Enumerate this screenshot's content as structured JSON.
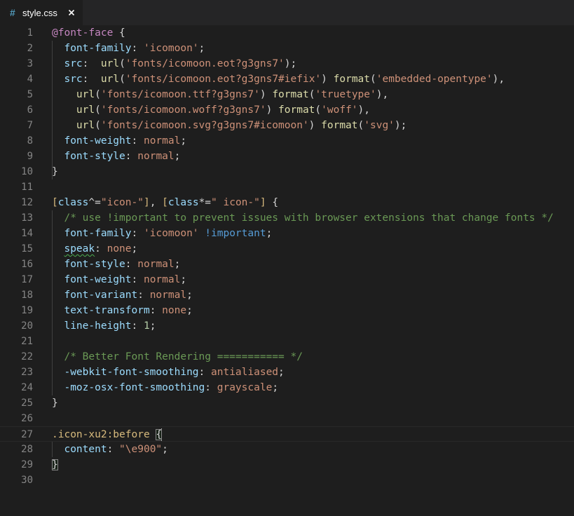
{
  "tab": {
    "icon_glyph": "#",
    "label": "style.css",
    "close_glyph": "×"
  },
  "lines": [
    {
      "num": "1",
      "tokens": [
        {
          "t": "@font-face",
          "c": "t-at"
        },
        {
          "t": " {",
          "c": "t-punc"
        }
      ]
    },
    {
      "num": "2",
      "tokens": [
        {
          "t": "  ",
          "c": "t-punc"
        },
        {
          "t": "font-family",
          "c": "t-prop"
        },
        {
          "t": ": ",
          "c": "t-punc"
        },
        {
          "t": "'icomoon'",
          "c": "t-str"
        },
        {
          "t": ";",
          "c": "t-punc"
        }
      ]
    },
    {
      "num": "3",
      "tokens": [
        {
          "t": "  ",
          "c": "t-punc"
        },
        {
          "t": "src",
          "c": "t-prop"
        },
        {
          "t": ":  ",
          "c": "t-punc"
        },
        {
          "t": "url",
          "c": "t-fn"
        },
        {
          "t": "(",
          "c": "t-punc"
        },
        {
          "t": "'fonts/icomoon.eot?g3gns7'",
          "c": "t-str"
        },
        {
          "t": ");",
          "c": "t-punc"
        }
      ]
    },
    {
      "num": "4",
      "tokens": [
        {
          "t": "  ",
          "c": "t-punc"
        },
        {
          "t": "src",
          "c": "t-prop"
        },
        {
          "t": ":  ",
          "c": "t-punc"
        },
        {
          "t": "url",
          "c": "t-fn"
        },
        {
          "t": "(",
          "c": "t-punc"
        },
        {
          "t": "'fonts/icomoon.eot?g3gns7#iefix'",
          "c": "t-str"
        },
        {
          "t": ") ",
          "c": "t-punc"
        },
        {
          "t": "format",
          "c": "t-fn"
        },
        {
          "t": "(",
          "c": "t-punc"
        },
        {
          "t": "'embedded-opentype'",
          "c": "t-str"
        },
        {
          "t": "),",
          "c": "t-punc"
        }
      ]
    },
    {
      "num": "5",
      "tokens": [
        {
          "t": "    ",
          "c": "t-punc"
        },
        {
          "t": "url",
          "c": "t-fn"
        },
        {
          "t": "(",
          "c": "t-punc"
        },
        {
          "t": "'fonts/icomoon.ttf?g3gns7'",
          "c": "t-str"
        },
        {
          "t": ") ",
          "c": "t-punc"
        },
        {
          "t": "format",
          "c": "t-fn"
        },
        {
          "t": "(",
          "c": "t-punc"
        },
        {
          "t": "'truetype'",
          "c": "t-str"
        },
        {
          "t": "),",
          "c": "t-punc"
        }
      ]
    },
    {
      "num": "6",
      "tokens": [
        {
          "t": "    ",
          "c": "t-punc"
        },
        {
          "t": "url",
          "c": "t-fn"
        },
        {
          "t": "(",
          "c": "t-punc"
        },
        {
          "t": "'fonts/icomoon.woff?g3gns7'",
          "c": "t-str"
        },
        {
          "t": ") ",
          "c": "t-punc"
        },
        {
          "t": "format",
          "c": "t-fn"
        },
        {
          "t": "(",
          "c": "t-punc"
        },
        {
          "t": "'woff'",
          "c": "t-str"
        },
        {
          "t": "),",
          "c": "t-punc"
        }
      ]
    },
    {
      "num": "7",
      "tokens": [
        {
          "t": "    ",
          "c": "t-punc"
        },
        {
          "t": "url",
          "c": "t-fn"
        },
        {
          "t": "(",
          "c": "t-punc"
        },
        {
          "t": "'fonts/icomoon.svg?g3gns7#icomoon'",
          "c": "t-str"
        },
        {
          "t": ") ",
          "c": "t-punc"
        },
        {
          "t": "format",
          "c": "t-fn"
        },
        {
          "t": "(",
          "c": "t-punc"
        },
        {
          "t": "'svg'",
          "c": "t-str"
        },
        {
          "t": ");",
          "c": "t-punc"
        }
      ]
    },
    {
      "num": "8",
      "tokens": [
        {
          "t": "  ",
          "c": "t-punc"
        },
        {
          "t": "font-weight",
          "c": "t-prop"
        },
        {
          "t": ": ",
          "c": "t-punc"
        },
        {
          "t": "normal",
          "c": "t-str"
        },
        {
          "t": ";",
          "c": "t-punc"
        }
      ]
    },
    {
      "num": "9",
      "tokens": [
        {
          "t": "  ",
          "c": "t-punc"
        },
        {
          "t": "font-style",
          "c": "t-prop"
        },
        {
          "t": ": ",
          "c": "t-punc"
        },
        {
          "t": "normal",
          "c": "t-str"
        },
        {
          "t": ";",
          "c": "t-punc"
        }
      ]
    },
    {
      "num": "10",
      "tokens": [
        {
          "t": "}",
          "c": "t-punc"
        }
      ]
    },
    {
      "num": "11",
      "tokens": []
    },
    {
      "num": "12",
      "tokens": [
        {
          "t": "[",
          "c": "t-sel"
        },
        {
          "t": "class",
          "c": "t-attr"
        },
        {
          "t": "^=",
          "c": "t-punc"
        },
        {
          "t": "\"icon-\"",
          "c": "t-str"
        },
        {
          "t": "]",
          "c": "t-sel"
        },
        {
          "t": ", ",
          "c": "t-punc"
        },
        {
          "t": "[",
          "c": "t-sel"
        },
        {
          "t": "class",
          "c": "t-attr"
        },
        {
          "t": "*=",
          "c": "t-punc"
        },
        {
          "t": "\" icon-\"",
          "c": "t-str"
        },
        {
          "t": "]",
          "c": "t-sel"
        },
        {
          "t": " {",
          "c": "t-punc"
        }
      ]
    },
    {
      "num": "13",
      "tokens": [
        {
          "t": "  ",
          "c": "t-punc"
        },
        {
          "t": "/* use !important to prevent issues with browser extensions that change fonts */",
          "c": "t-cm"
        }
      ]
    },
    {
      "num": "14",
      "tokens": [
        {
          "t": "  ",
          "c": "t-punc"
        },
        {
          "t": "font-family",
          "c": "t-prop"
        },
        {
          "t": ": ",
          "c": "t-punc"
        },
        {
          "t": "'icomoon'",
          "c": "t-str"
        },
        {
          "t": " ",
          "c": "t-punc"
        },
        {
          "t": "!important",
          "c": "t-kw"
        },
        {
          "t": ";",
          "c": "t-punc"
        }
      ]
    },
    {
      "num": "15",
      "tokens": [
        {
          "t": "  ",
          "c": "t-punc"
        },
        {
          "t": "speak",
          "c": "t-prop squiggle"
        },
        {
          "t": ": ",
          "c": "t-punc"
        },
        {
          "t": "none",
          "c": "t-str"
        },
        {
          "t": ";",
          "c": "t-punc"
        }
      ]
    },
    {
      "num": "16",
      "tokens": [
        {
          "t": "  ",
          "c": "t-punc"
        },
        {
          "t": "font-style",
          "c": "t-prop"
        },
        {
          "t": ": ",
          "c": "t-punc"
        },
        {
          "t": "normal",
          "c": "t-str"
        },
        {
          "t": ";",
          "c": "t-punc"
        }
      ]
    },
    {
      "num": "17",
      "tokens": [
        {
          "t": "  ",
          "c": "t-punc"
        },
        {
          "t": "font-weight",
          "c": "t-prop"
        },
        {
          "t": ": ",
          "c": "t-punc"
        },
        {
          "t": "normal",
          "c": "t-str"
        },
        {
          "t": ";",
          "c": "t-punc"
        }
      ]
    },
    {
      "num": "18",
      "tokens": [
        {
          "t": "  ",
          "c": "t-punc"
        },
        {
          "t": "font-variant",
          "c": "t-prop"
        },
        {
          "t": ": ",
          "c": "t-punc"
        },
        {
          "t": "normal",
          "c": "t-str"
        },
        {
          "t": ";",
          "c": "t-punc"
        }
      ]
    },
    {
      "num": "19",
      "tokens": [
        {
          "t": "  ",
          "c": "t-punc"
        },
        {
          "t": "text-transform",
          "c": "t-prop"
        },
        {
          "t": ": ",
          "c": "t-punc"
        },
        {
          "t": "none",
          "c": "t-str"
        },
        {
          "t": ";",
          "c": "t-punc"
        }
      ]
    },
    {
      "num": "20",
      "tokens": [
        {
          "t": "  ",
          "c": "t-punc"
        },
        {
          "t": "line-height",
          "c": "t-prop"
        },
        {
          "t": ": ",
          "c": "t-punc"
        },
        {
          "t": "1",
          "c": "t-num"
        },
        {
          "t": ";",
          "c": "t-punc"
        }
      ]
    },
    {
      "num": "21",
      "tokens": []
    },
    {
      "num": "22",
      "tokens": [
        {
          "t": "  ",
          "c": "t-punc"
        },
        {
          "t": "/* Better Font Rendering =========== */",
          "c": "t-cm"
        }
      ]
    },
    {
      "num": "23",
      "tokens": [
        {
          "t": "  ",
          "c": "t-punc"
        },
        {
          "t": "-webkit-font-smoothing",
          "c": "t-prop"
        },
        {
          "t": ": ",
          "c": "t-punc"
        },
        {
          "t": "antialiased",
          "c": "t-str"
        },
        {
          "t": ";",
          "c": "t-punc"
        }
      ]
    },
    {
      "num": "24",
      "tokens": [
        {
          "t": "  ",
          "c": "t-punc"
        },
        {
          "t": "-moz-osx-font-smoothing",
          "c": "t-prop"
        },
        {
          "t": ": ",
          "c": "t-punc"
        },
        {
          "t": "grayscale",
          "c": "t-str"
        },
        {
          "t": ";",
          "c": "t-punc"
        }
      ]
    },
    {
      "num": "25",
      "tokens": [
        {
          "t": "}",
          "c": "t-punc"
        }
      ]
    },
    {
      "num": "26",
      "tokens": []
    },
    {
      "num": "27",
      "current": true,
      "tokens": [
        {
          "t": ".icon-xu2:before",
          "c": "t-sel"
        },
        {
          "t": " ",
          "c": "t-punc"
        },
        {
          "t": "{",
          "c": "t-punc bracket-match"
        },
        {
          "t": "",
          "c": "cursor"
        }
      ]
    },
    {
      "num": "28",
      "tokens": [
        {
          "t": "  ",
          "c": "t-punc"
        },
        {
          "t": "content",
          "c": "t-prop"
        },
        {
          "t": ": ",
          "c": "t-punc"
        },
        {
          "t": "\"\\e900\"",
          "c": "t-str"
        },
        {
          "t": ";",
          "c": "t-punc"
        }
      ]
    },
    {
      "num": "29",
      "tokens": [
        {
          "t": "}",
          "c": "t-punc bracket-match"
        }
      ]
    },
    {
      "num": "30",
      "tokens": []
    }
  ],
  "colors": {
    "background": "#1e1e1e",
    "tabbar": "#252526",
    "line_number": "#858585",
    "at_rule": "#c586c0",
    "selector": "#d7ba7d",
    "property": "#9cdcfe",
    "string": "#ce9178",
    "function": "#dcdcaa",
    "comment": "#6a9955",
    "keyword": "#569cd6",
    "number": "#b5cea8"
  }
}
